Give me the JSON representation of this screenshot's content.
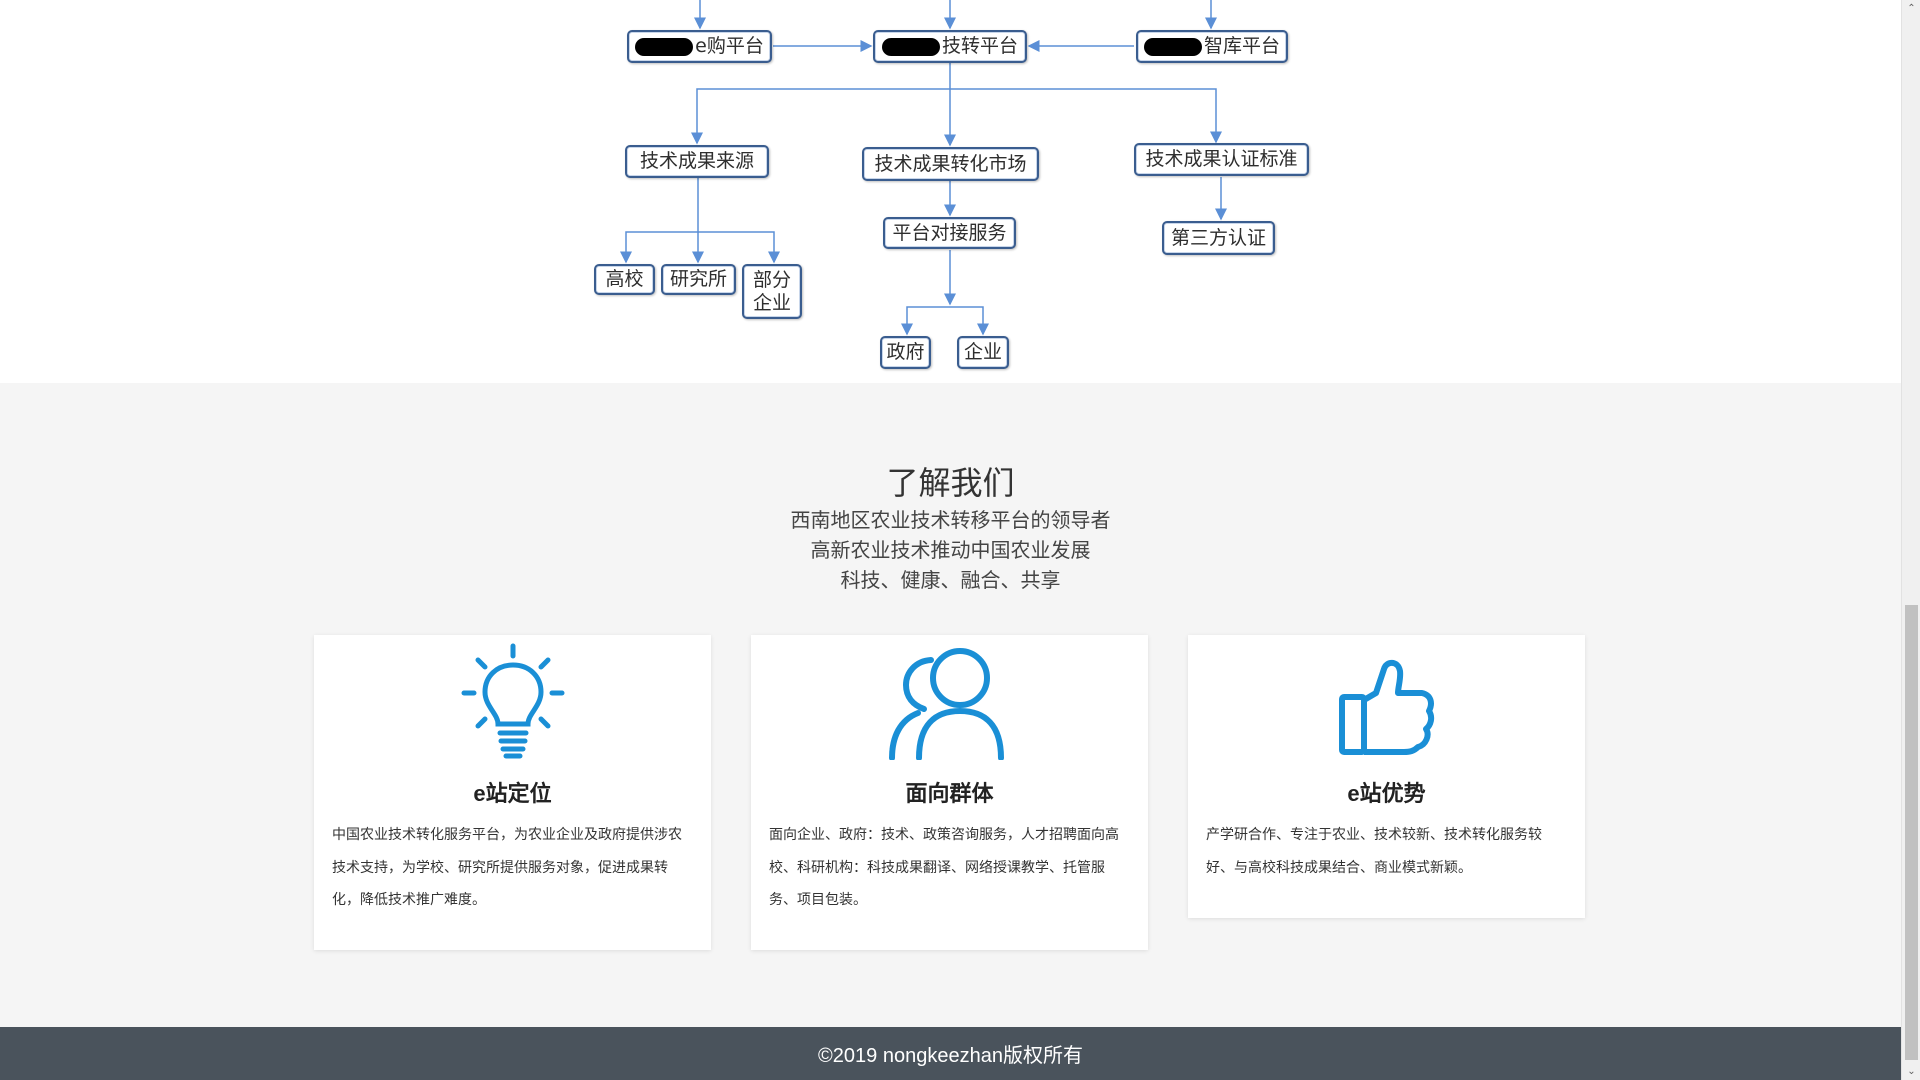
{
  "diagram": {
    "nodes": {
      "egou": "e购平台",
      "jizhuan": "技转平台",
      "zhiku": "智库平台",
      "source": "技术成果来源",
      "market": "技术成果转化市场",
      "standard": "技术成果认证标准",
      "docking": "平台对接服务",
      "thirdparty": "第三方认证",
      "university": "高校",
      "institute": "研究所",
      "someenterprise": "部分\n企业",
      "government": "政府",
      "enterprise": "企业"
    },
    "line_color": "#5b8fd6"
  },
  "about": {
    "title": "了解我们",
    "lines": [
      "西南地区农业技术转移平台的领导者",
      "高新农业技术推动中国农业发展",
      "科技、健康、融合、共享"
    ],
    "cards": [
      {
        "icon": "lightbulb-icon",
        "title": "e站定位",
        "text": "中国农业技术转化服务平台，为农业企业及政府提供涉农技术支持，为学校、研究所提供服务对象，促进成果转化，降低技术推广难度。"
      },
      {
        "icon": "users-icon",
        "title": "面向群体",
        "text": "面向企业、政府：技术、政策咨询服务，人才招聘面向高校、科研机构：科技成果翻译、网络授课教学、托管服务、项目包装。"
      },
      {
        "icon": "thumbs-up-icon",
        "title": "e站优势",
        "text": "产学研合作、专注于农业、技术较新、技术转化服务较好、与高校科技成果结合、商业模式新颖。"
      }
    ],
    "icon_color": "#1a8fd6"
  },
  "footer": {
    "text": "©2019 nongkeezhan版权所有"
  },
  "scrollbar": {
    "up_arrow": "⌃",
    "down_arrow": "⌄"
  }
}
